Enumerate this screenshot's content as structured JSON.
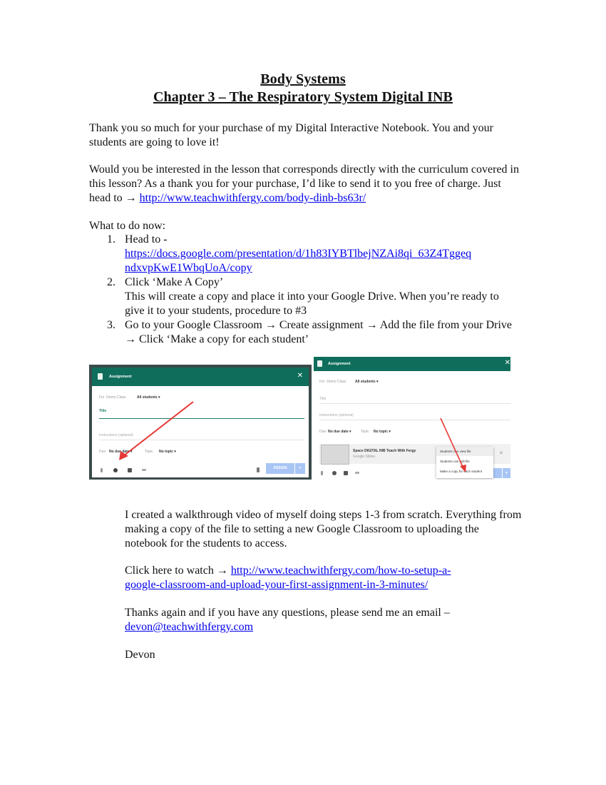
{
  "document": {
    "title": "Body Systems",
    "subtitle": "Chapter 3 – The Respiratory System Digital INB",
    "intro": "Thank you so much for your purchase of my Digital Interactive Notebook. You and your students are going to love it!",
    "offer_text": "Would you be interested in the lesson that corresponds directly with the curriculum covered in this lesson? As a thank you for your purchase, I’d like to send it to you free of charge. Just head to → ",
    "offer_link": "http://www.teachwithfergy.com/body-dinb-bs63r/",
    "steps_heading": "What to do now:",
    "steps": [
      {
        "num": "1.",
        "text": "Head to -",
        "link": "https://docs.google.com/presentation/d/1h83IYBTlbejNZAi8qi_63Z4TggeqndxvpKwE1WbqUoA/copy",
        "link_line1": "https://docs.google.com/presentation/d/1h83IYBTlbejNZAi8qi_63Z4Tggeq",
        "link_line2": "ndxvpKwE1WbqUoA/copy"
      },
      {
        "num": "2.",
        "text": "Click ‘Make A Copy’",
        "detail": "This will create a copy and place it into your Google Drive. When you’re ready to give it to your students, procedure to #3"
      },
      {
        "num": "3.",
        "text": "Go to your Google Classroom → Create assignment → Add the file from your Drive → Click ‘Make a copy for each student’"
      }
    ],
    "video_text": "I created a walkthrough video of myself doing steps 1-3 from scratch. Everything from making a copy of the file to setting a new Google Classroom to uploading the notebook for the students to access.",
    "watch_text": "Click here to watch → ",
    "watch_link_line1": "http://www.teachwithfergy.com/how-to-setup-a-",
    "watch_link_line2": "google-classroom-and-upload-your-first-assignment-in-3-minutes/",
    "contact_text": "Thanks again and if you have any questions, please send me an email –",
    "contact_email": "devon@teachwithfergy.com",
    "signature": "Devon"
  },
  "screenshot1": {
    "header": "Assignment",
    "for_label": "For",
    "class_name": "Demo Class",
    "students": "All students ▾",
    "title_label": "Title",
    "instructions": "Instructions (optional)",
    "due_label": "Due",
    "due_value": "No due date ▾",
    "topic_label": "Topic",
    "topic_value": "No topic ▾",
    "assign_button": "ASSIGN",
    "close": "✕"
  },
  "screenshot2": {
    "header": "Assignment",
    "for_label": "For",
    "class_name": "Demo Class",
    "students": "All students ▾",
    "title_label": "Title",
    "instructions": "Instructions (optional)",
    "due_label": "Due",
    "due_value": "No due date ▾",
    "topic_label": "Topic",
    "topic_value": "No topic ▾",
    "attachment_title": "Space DIGITAL INB Teach With Fergy",
    "attachment_type": "Google Slides",
    "menu_items": [
      "Students can view file",
      "Students can edit file",
      "Make a copy for each student"
    ],
    "close": "✕"
  },
  "colors": {
    "header_green": "#0f6e5b",
    "link_blue": "#0000ee",
    "arrow_red": "#e53935"
  }
}
